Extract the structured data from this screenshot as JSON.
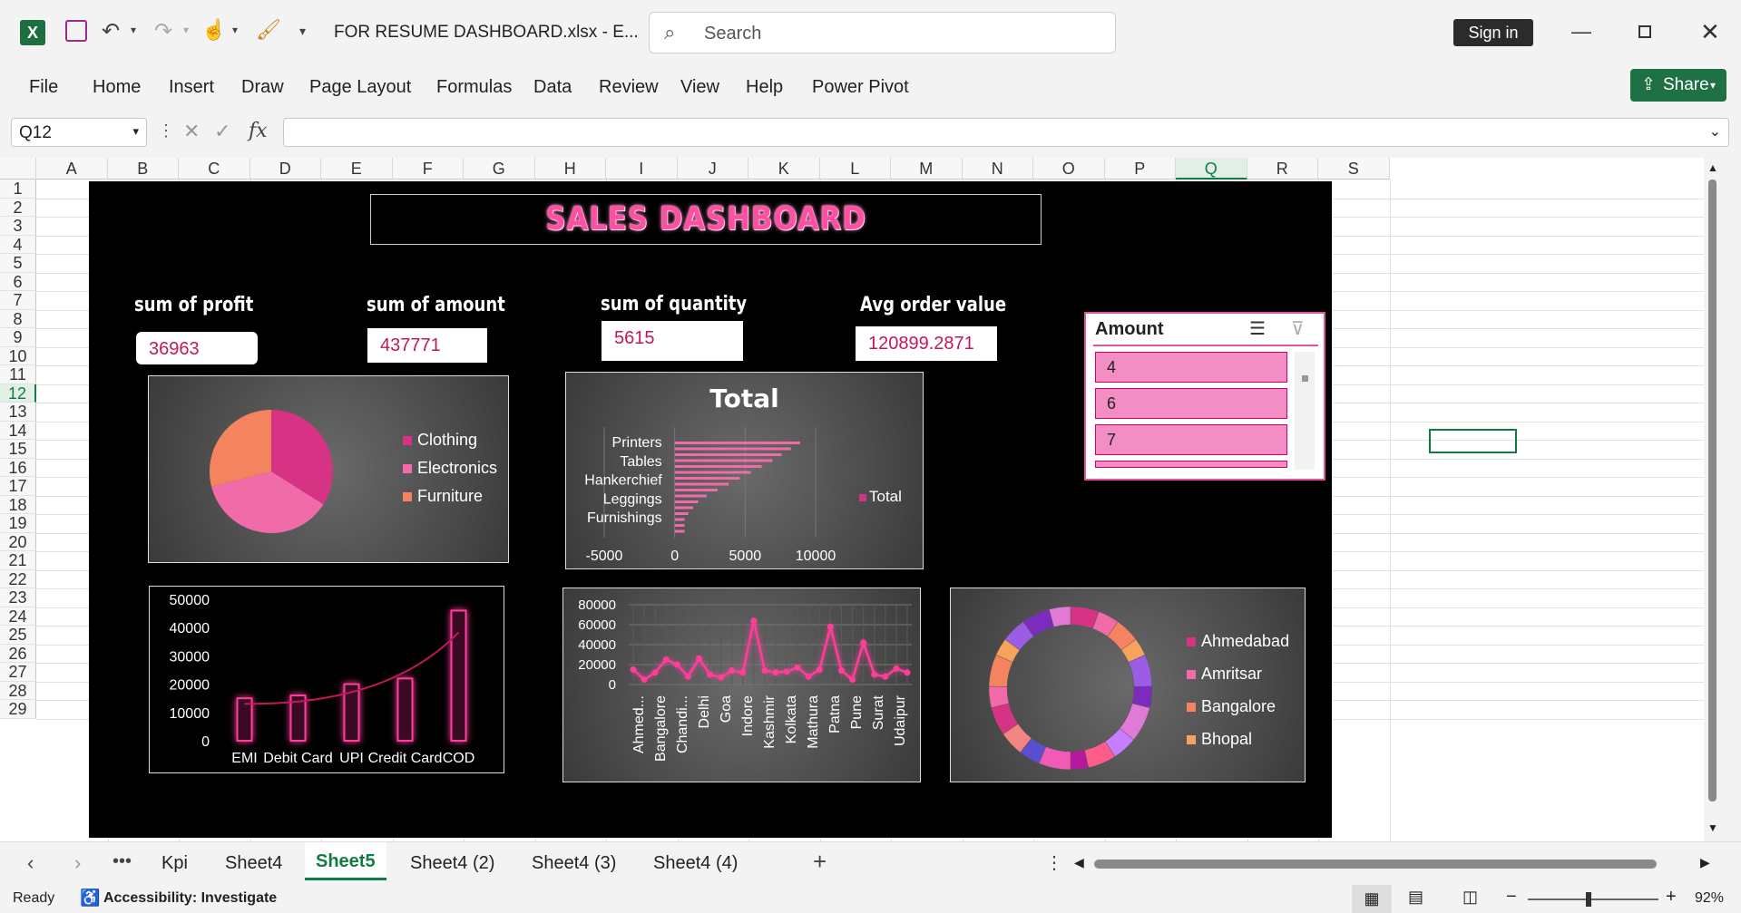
{
  "titlebar": {
    "filename": "FOR RESUME DASHBOARD.xlsx  -  E...",
    "search_placeholder": "Search",
    "signin": "Sign in"
  },
  "ribbon": {
    "tabs": [
      "File",
      "Home",
      "Insert",
      "Draw",
      "Page Layout",
      "Formulas",
      "Data",
      "Review",
      "View",
      "Help",
      "Power Pivot"
    ],
    "share": "Share"
  },
  "formula_bar": {
    "namebox": "Q12",
    "value": ""
  },
  "columns": [
    "A",
    "B",
    "C",
    "D",
    "E",
    "F",
    "G",
    "H",
    "I",
    "J",
    "K",
    "L",
    "M",
    "N",
    "O",
    "P",
    "Q",
    "R",
    "S"
  ],
  "rows": [
    "1",
    "2",
    "3",
    "4",
    "5",
    "6",
    "7",
    "8",
    "9",
    "10",
    "11",
    "12",
    "13",
    "14",
    "15",
    "16",
    "17",
    "18",
    "19",
    "20",
    "21",
    "22",
    "23",
    "24",
    "25",
    "26",
    "27",
    "28",
    "29"
  ],
  "dashboard": {
    "title": "SALES DASHBOARD",
    "kpis": [
      {
        "label": "sum of profit",
        "value": "36963"
      },
      {
        "label": "sum of amount",
        "value": "437771"
      },
      {
        "label": "sum of quantity",
        "value": "5615"
      },
      {
        "label": "Avg order value",
        "value": "120899.2871"
      }
    ],
    "slicer": {
      "title": "Amount",
      "items": [
        "4",
        "6",
        "7"
      ]
    }
  },
  "chart_data": [
    {
      "type": "pie",
      "categories": [
        "Clothing",
        "Electronics",
        "Furniture"
      ],
      "values": [
        34,
        37,
        29
      ],
      "colors": [
        "#d63384",
        "#f06ba8",
        "#f4845f"
      ]
    },
    {
      "type": "bar",
      "title": "Total",
      "orientation": "horizontal",
      "categories": [
        "Printers",
        "Tables",
        "Hankerchief",
        "Leggings",
        "Furnishings"
      ],
      "series": [
        {
          "name": "Total",
          "values": [
            8900,
            6800,
            4300,
            1800,
            700
          ]
        }
      ],
      "xticks": [
        "-5000",
        "0",
        "5000",
        "10000"
      ],
      "xlim": [
        -5000,
        10000
      ]
    },
    {
      "type": "bar",
      "categories": [
        "EMI",
        "Debit Card",
        "UPI",
        "Credit Card",
        "COD"
      ],
      "values": [
        15000,
        16000,
        20000,
        22000,
        46000
      ],
      "yticks": [
        "50000",
        "40000",
        "30000",
        "20000",
        "10000",
        "0"
      ],
      "ylim": [
        0,
        50000
      ],
      "trendline": true
    },
    {
      "type": "line",
      "categories": [
        "Ahmed...",
        "Bangalore",
        "Chandi...",
        "Delhi",
        "Goa",
        "Indore",
        "Kashmir",
        "Kolkata",
        "Mathura",
        "Patna",
        "Pune",
        "Surat",
        "Udaipur"
      ],
      "values": [
        15000,
        5000,
        12000,
        25000,
        20000,
        8000,
        26000,
        10000,
        7000,
        14000,
        12000,
        64000,
        14000,
        12000,
        13000,
        17000,
        8000,
        15000,
        58000,
        14000,
        5000,
        42000,
        10000,
        8000,
        16000,
        12000
      ],
      "yticks": [
        "80000",
        "60000",
        "40000",
        "20000",
        "0"
      ],
      "ylim": [
        0,
        80000
      ]
    },
    {
      "type": "pie",
      "subtype": "donut",
      "categories": [
        "Ahmedabad",
        "Amritsar",
        "Bangalore",
        "Bhopal"
      ],
      "colors": [
        "#d63384",
        "#f06ba8",
        "#f4845f",
        "#f7a35c"
      ]
    }
  ],
  "sheet_tabs": [
    "Kpi",
    "Sheet4",
    "Sheet5",
    "Sheet4 (2)",
    "Sheet4 (3)",
    "Sheet4 (4)"
  ],
  "active_sheet": "Sheet5",
  "status": {
    "ready": "Ready",
    "accessibility": "Accessibility: Investigate",
    "zoom": "92%"
  }
}
